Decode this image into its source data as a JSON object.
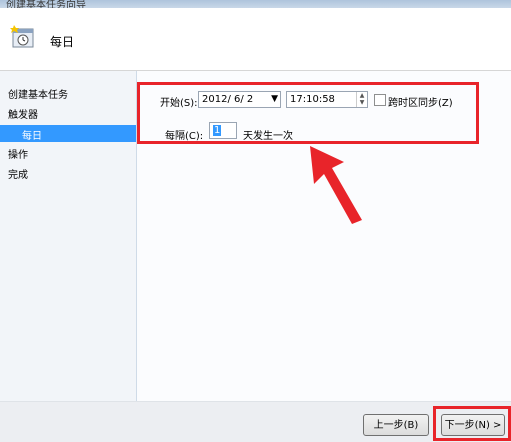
{
  "window": {
    "title": "创建基本任务向导"
  },
  "header": {
    "title": "每日",
    "icon": "calendar-clock-icon"
  },
  "nav": {
    "items": [
      {
        "label": "创建基本任务"
      },
      {
        "label": "触发器"
      },
      {
        "label": "每日",
        "active": true
      },
      {
        "label": "操作"
      },
      {
        "label": "完成"
      }
    ]
  },
  "form": {
    "start_label": "开始(S):",
    "start_date": "2012/  6/  2",
    "start_time": "17:10:58",
    "sync_timezone_label": "跨时区同步(Z)",
    "sync_timezone_checked": false,
    "recur_label": "每隔(C):",
    "recur_value": "1",
    "recur_suffix": "天发生一次"
  },
  "footer": {
    "back_label": "上一步(B)",
    "next_label": "下一步(N) >"
  },
  "colors": {
    "highlight": "#e8242a",
    "selection": "#3399ff"
  }
}
